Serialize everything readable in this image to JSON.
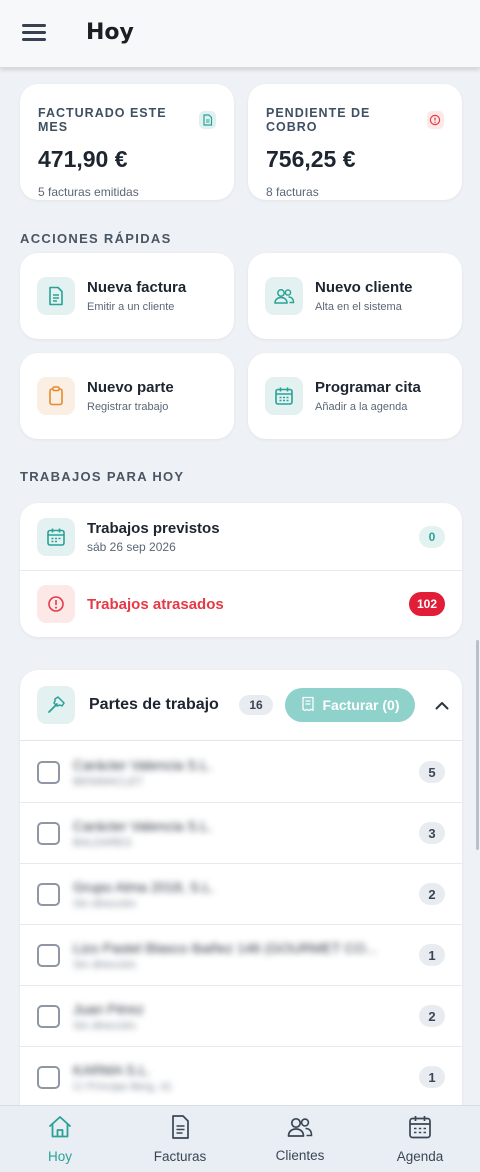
{
  "header": {
    "title": "Hoy"
  },
  "stats": [
    {
      "label": "FACTURADO ESTE MES",
      "value": "471,90 €",
      "sub": "5 facturas emitidas",
      "icon": "document-icon",
      "color": "#2aa197"
    },
    {
      "label": "PENDIENTE DE COBRO",
      "value": "756,25 €",
      "sub": "8 facturas",
      "icon": "alert-icon",
      "color": "#e53945"
    }
  ],
  "quick_actions": {
    "title": "ACCIONES RÁPIDAS",
    "items": [
      {
        "title": "Nueva factura",
        "sub": "Emitir a un cliente",
        "icon": "invoice-icon"
      },
      {
        "title": "Nuevo cliente",
        "sub": "Alta en el sistema",
        "icon": "users-icon"
      },
      {
        "title": "Nuevo parte",
        "sub": "Registrar trabajo",
        "icon": "clipboard-icon"
      },
      {
        "title": "Programar cita",
        "sub": "Añadir a la agenda",
        "icon": "calendar-icon"
      }
    ]
  },
  "trabajos": {
    "title": "TRABAJOS PARA HOY",
    "previstos": {
      "title": "Trabajos previstos",
      "date": "sáb 26 sep 2026",
      "count": "0"
    },
    "atrasados": {
      "title": "Trabajos atrasados",
      "count": "102"
    }
  },
  "partes": {
    "title": "Partes de trabajo",
    "count": "16",
    "facturar_label": "Facturar (0)",
    "rows": [
      {
        "name": "Carácter Valencia S.L.",
        "sub": "BENIMACLET",
        "count": "5"
      },
      {
        "name": "Carácter Valencia S.L.",
        "sub": "BALDARES",
        "count": "3"
      },
      {
        "name": "Grupo Alma 2018, S.L.",
        "sub": "Sin dirección",
        "count": "2"
      },
      {
        "name": "Lizo Pastel Blasco Ibañez 146 (GOURMET CO...",
        "sub": "Sin dirección",
        "count": "1"
      },
      {
        "name": "Juan Pérez",
        "sub": "Sin dirección",
        "count": "2"
      },
      {
        "name": "KARMA S.L.",
        "sub": "C/ Príncipe Berg, 41",
        "count": "1"
      }
    ]
  },
  "nav": [
    {
      "label": "Hoy",
      "icon": "home-icon",
      "active": true
    },
    {
      "label": "Facturas",
      "icon": "invoice-icon",
      "active": false
    },
    {
      "label": "Clientes",
      "icon": "users-icon",
      "active": false
    },
    {
      "label": "Agenda",
      "icon": "calendar-icon",
      "active": false
    }
  ],
  "colors": {
    "accent": "#2aa197",
    "danger": "#e53945",
    "background": "#eef1f5"
  }
}
